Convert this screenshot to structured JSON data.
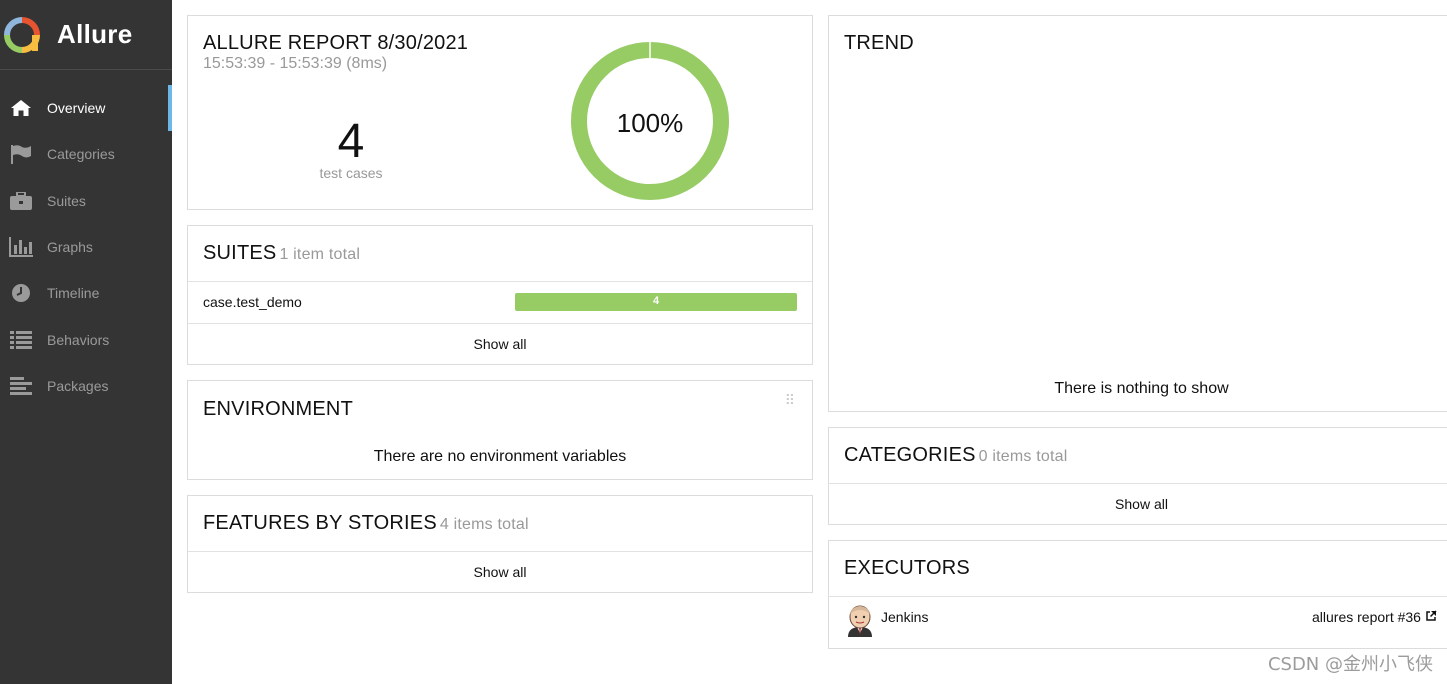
{
  "app": {
    "name": "Allure"
  },
  "sidebar": {
    "items": [
      {
        "label": "Overview",
        "icon": "home-icon",
        "active": true
      },
      {
        "label": "Categories",
        "icon": "flag-icon"
      },
      {
        "label": "Suites",
        "icon": "briefcase-icon"
      },
      {
        "label": "Graphs",
        "icon": "bar-chart-icon"
      },
      {
        "label": "Timeline",
        "icon": "clock-icon"
      },
      {
        "label": "Behaviors",
        "icon": "list-icon"
      },
      {
        "label": "Packages",
        "icon": "align-left-icon"
      }
    ]
  },
  "report": {
    "title": "ALLURE REPORT 8/30/2021",
    "time": "15:53:39 - 15:53:39 (8ms)",
    "count": "4",
    "count_label": "test cases",
    "percent_text": "100%",
    "pass_fraction": 1.0,
    "pass_color": "#97cc64"
  },
  "suites": {
    "title": "SUITES",
    "subtitle": "1 item total",
    "rows": [
      {
        "name": "case.test_demo",
        "count": "4",
        "fraction": 1.0
      }
    ],
    "show_all": "Show all"
  },
  "environment": {
    "title": "ENVIRONMENT",
    "empty": "There are no environment variables"
  },
  "features": {
    "title": "FEATURES BY STORIES",
    "subtitle": "4 items total",
    "show_all": "Show all"
  },
  "trend": {
    "title": "TREND",
    "empty": "There is nothing to show"
  },
  "categories": {
    "title": "CATEGORIES",
    "subtitle": "0 items total",
    "show_all": "Show all"
  },
  "executors": {
    "title": "EXECUTORS",
    "name": "Jenkins",
    "link": "allures report #36"
  },
  "watermark": "CSDN @金州小飞侠"
}
